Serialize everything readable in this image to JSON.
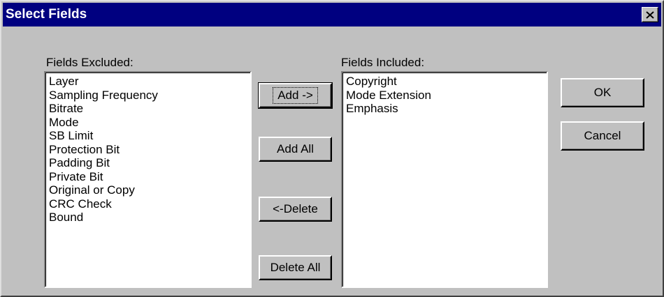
{
  "dialog": {
    "title": "Select Fields",
    "close_icon": "close-icon"
  },
  "excluded": {
    "label": "Fields Excluded:",
    "items": [
      "Layer",
      "Sampling Frequency",
      "Bitrate",
      "Mode",
      "SB Limit",
      "Protection Bit",
      "Padding Bit",
      "Private Bit",
      "Original or Copy",
      "CRC Check",
      "Bound"
    ]
  },
  "included": {
    "label": "Fields Included:",
    "items": [
      "Copyright",
      "Mode Extension",
      "Emphasis"
    ]
  },
  "buttons": {
    "add": "Add ->",
    "add_all": "Add All",
    "delete": "<-Delete",
    "delete_all": "Delete All",
    "ok": "OK",
    "cancel": "Cancel"
  },
  "colors": {
    "titlebar": "#000080",
    "face": "#c0c0c0"
  }
}
